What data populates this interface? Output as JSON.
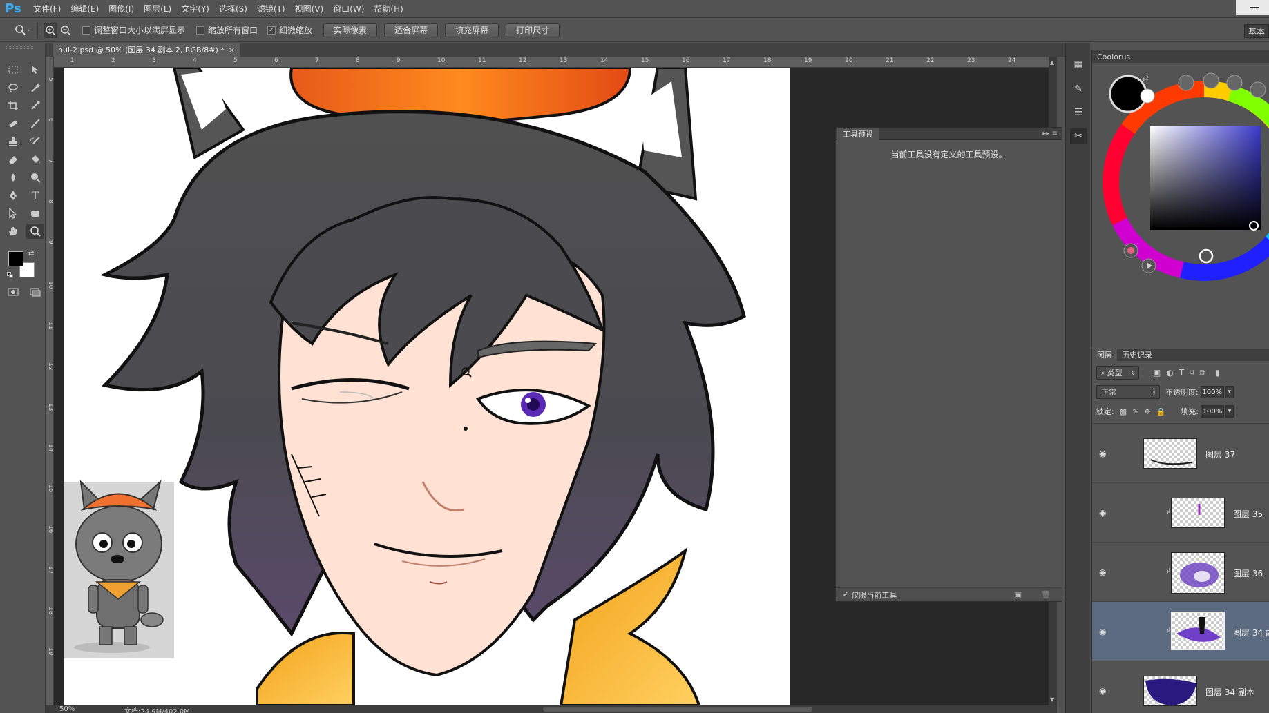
{
  "app": {
    "logo": "Ps",
    "menu": [
      "文件(F)",
      "编辑(E)",
      "图像(I)",
      "图层(L)",
      "文字(Y)",
      "选择(S)",
      "滤镜(T)",
      "视图(V)",
      "窗口(W)",
      "帮助(H)"
    ]
  },
  "options_bar": {
    "resize_windows_label": "调整窗口大小以满屏显示",
    "resize_windows_checked": false,
    "zoom_all_windows_label": "缩放所有窗口",
    "zoom_all_windows_checked": false,
    "scrubby_zoom_label": "细微缩放",
    "scrubby_zoom_checked": true,
    "buttons": [
      "实际像素",
      "适合屏幕",
      "填充屏幕",
      "打印尺寸"
    ],
    "workspace_label": "基本"
  },
  "document": {
    "tab_title": "hui-2.psd @ 50% (图层 34 副本 2, RGB/8#) *",
    "ruler_top_numbers": [
      "1",
      "2",
      "3",
      "4",
      "5",
      "6",
      "7",
      "8",
      "9",
      "10",
      "11",
      "12",
      "13",
      "14",
      "15",
      "16",
      "17",
      "18",
      "19",
      "20",
      "21",
      "22",
      "23",
      "24"
    ],
    "ruler_left_numbers": [
      "5",
      "6",
      "7",
      "8",
      "9",
      "10",
      "11",
      "12",
      "13",
      "14",
      "15",
      "16",
      "17",
      "18",
      "19"
    ],
    "zoom": "50%",
    "doc_info": "文档:24.9M/402.0M"
  },
  "tool_presets": {
    "tab": "工具预设",
    "message": "当前工具没有定义的工具预设。",
    "only_current_label": "仅限当前工具",
    "only_current_checked": true
  },
  "coolorus": {
    "title": "Coolorus",
    "fg_color": "#000000",
    "bg_color": "#ffffff"
  },
  "layers": {
    "tabs": [
      "图层",
      "历史记录"
    ],
    "filter_label": "类型",
    "blend_mode": "正常",
    "opacity_label": "不透明度:",
    "opacity": "100%",
    "lock_label": "锁定:",
    "fill_label": "填充:",
    "fill": "100%",
    "items": [
      {
        "name": "图层 37",
        "clipped": false,
        "selected": false
      },
      {
        "name": "图层 35",
        "clipped": true,
        "selected": false
      },
      {
        "name": "图层 36",
        "clipped": true,
        "selected": false
      },
      {
        "name": "图层 34 副",
        "clipped": true,
        "selected": true
      },
      {
        "name": "图层 34 副本",
        "clipped": false,
        "selected": false
      }
    ]
  }
}
